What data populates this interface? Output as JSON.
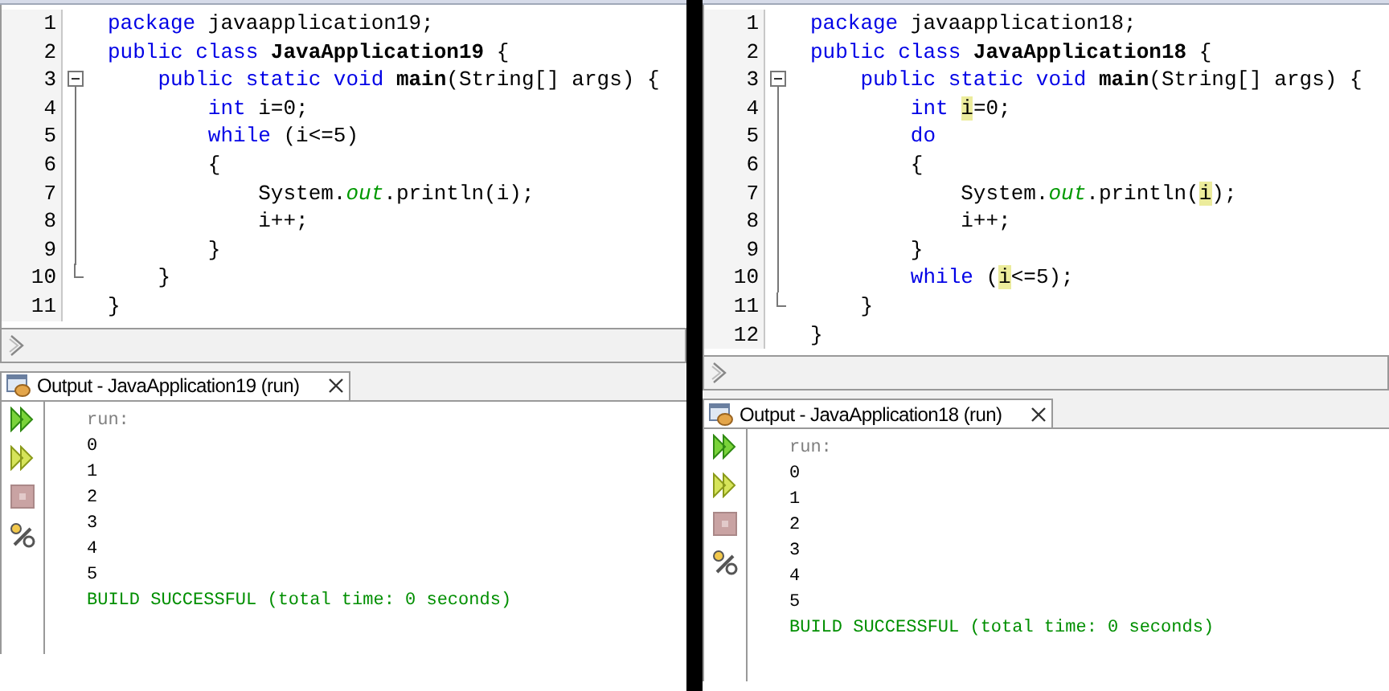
{
  "panels": [
    {
      "editor": {
        "lines": [
          {
            "number": "1",
            "tokens": [
              {
                "text": "package",
                "kind": "keyword"
              },
              {
                "text": " javaapplication19;",
                "kind": "plain"
              }
            ]
          },
          {
            "number": "2",
            "tokens": [
              {
                "text": "public class",
                "kind": "keyword"
              },
              {
                "text": " JavaApplication19",
                "kind": "bold"
              },
              {
                "text": " {",
                "kind": "plain"
              }
            ]
          },
          {
            "number": "3",
            "fold_start": true,
            "tokens": [
              {
                "text": "    public static void",
                "kind": "keyword"
              },
              {
                "text": " main",
                "kind": "bold"
              },
              {
                "text": "(String[] args) {",
                "kind": "plain"
              }
            ]
          },
          {
            "number": "4",
            "in_fold": true,
            "tokens": [
              {
                "text": "        int",
                "kind": "keyword"
              },
              {
                "text": " i=0;",
                "kind": "plain"
              }
            ]
          },
          {
            "number": "5",
            "in_fold": true,
            "tokens": [
              {
                "text": "        while",
                "kind": "keyword"
              },
              {
                "text": " (i<=5)",
                "kind": "plain"
              }
            ]
          },
          {
            "number": "6",
            "in_fold": true,
            "tokens": [
              {
                "text": "        {",
                "kind": "plain"
              }
            ]
          },
          {
            "number": "7",
            "in_fold": true,
            "tokens": [
              {
                "text": "            System.",
                "kind": "plain"
              },
              {
                "text": "out",
                "kind": "field"
              },
              {
                "text": ".println(i);",
                "kind": "plain"
              }
            ]
          },
          {
            "number": "8",
            "in_fold": true,
            "tokens": [
              {
                "text": "            i++;",
                "kind": "plain"
              }
            ]
          },
          {
            "number": "9",
            "in_fold": true,
            "tokens": [
              {
                "text": "        }",
                "kind": "plain"
              }
            ]
          },
          {
            "number": "10",
            "fold_end": true,
            "tokens": [
              {
                "text": "    }",
                "kind": "plain"
              }
            ]
          },
          {
            "number": "11",
            "tokens": [
              {
                "text": "}",
                "kind": "plain"
              }
            ]
          }
        ]
      },
      "output": {
        "title": "Output - JavaApplication19 (run)",
        "lines": [
          {
            "text": "run:",
            "kind": "info"
          },
          {
            "text": "0",
            "kind": "plain"
          },
          {
            "text": "1",
            "kind": "plain"
          },
          {
            "text": "2",
            "kind": "plain"
          },
          {
            "text": "3",
            "kind": "plain"
          },
          {
            "text": "4",
            "kind": "plain"
          },
          {
            "text": "5",
            "kind": "plain"
          },
          {
            "text": "BUILD SUCCESSFUL (total time: 0 seconds)",
            "kind": "success"
          }
        ]
      }
    },
    {
      "editor": {
        "lines": [
          {
            "number": "1",
            "tokens": [
              {
                "text": "package",
                "kind": "keyword"
              },
              {
                "text": " javaapplication18;",
                "kind": "plain"
              }
            ]
          },
          {
            "number": "2",
            "tokens": [
              {
                "text": "public class",
                "kind": "keyword"
              },
              {
                "text": " JavaApplication18",
                "kind": "bold"
              },
              {
                "text": " {",
                "kind": "plain"
              }
            ]
          },
          {
            "number": "3",
            "fold_start": true,
            "tokens": [
              {
                "text": "    public static void",
                "kind": "keyword"
              },
              {
                "text": " main",
                "kind": "bold"
              },
              {
                "text": "(String[] args) {",
                "kind": "plain"
              }
            ]
          },
          {
            "number": "4",
            "in_fold": true,
            "tokens": [
              {
                "text": "        int ",
                "kind": "keyword"
              },
              {
                "text": "i",
                "kind": "highlight"
              },
              {
                "text": "=0;",
                "kind": "plain"
              }
            ]
          },
          {
            "number": "5",
            "in_fold": true,
            "tokens": [
              {
                "text": "        do",
                "kind": "keyword"
              }
            ]
          },
          {
            "number": "6",
            "in_fold": true,
            "tokens": [
              {
                "text": "        {",
                "kind": "plain"
              }
            ]
          },
          {
            "number": "7",
            "in_fold": true,
            "tokens": [
              {
                "text": "            System.",
                "kind": "plain"
              },
              {
                "text": "out",
                "kind": "field"
              },
              {
                "text": ".println(",
                "kind": "plain"
              },
              {
                "text": "i",
                "kind": "highlight"
              },
              {
                "text": ");",
                "kind": "plain"
              }
            ]
          },
          {
            "number": "8",
            "in_fold": true,
            "tokens": [
              {
                "text": "            i++;",
                "kind": "plain"
              }
            ]
          },
          {
            "number": "9",
            "in_fold": true,
            "tokens": [
              {
                "text": "        }",
                "kind": "plain"
              }
            ]
          },
          {
            "number": "10",
            "in_fold": true,
            "tokens": [
              {
                "text": "        while",
                "kind": "keyword"
              },
              {
                "text": " (",
                "kind": "plain"
              },
              {
                "text": "i",
                "kind": "highlight"
              },
              {
                "text": "<=5);",
                "kind": "plain"
              }
            ]
          },
          {
            "number": "11",
            "fold_end": true,
            "tokens": [
              {
                "text": "    }",
                "kind": "plain"
              }
            ]
          },
          {
            "number": "12",
            "tokens": [
              {
                "text": "}",
                "kind": "plain"
              }
            ]
          }
        ]
      },
      "output": {
        "title": "Output - JavaApplication18 (run)",
        "lines": [
          {
            "text": "run:",
            "kind": "info"
          },
          {
            "text": "0",
            "kind": "plain"
          },
          {
            "text": "1",
            "kind": "plain"
          },
          {
            "text": "2",
            "kind": "plain"
          },
          {
            "text": "3",
            "kind": "plain"
          },
          {
            "text": "4",
            "kind": "plain"
          },
          {
            "text": "5",
            "kind": "plain"
          },
          {
            "text": "BUILD SUCCESSFUL (total time: 0 seconds)",
            "kind": "success"
          }
        ]
      }
    }
  ]
}
